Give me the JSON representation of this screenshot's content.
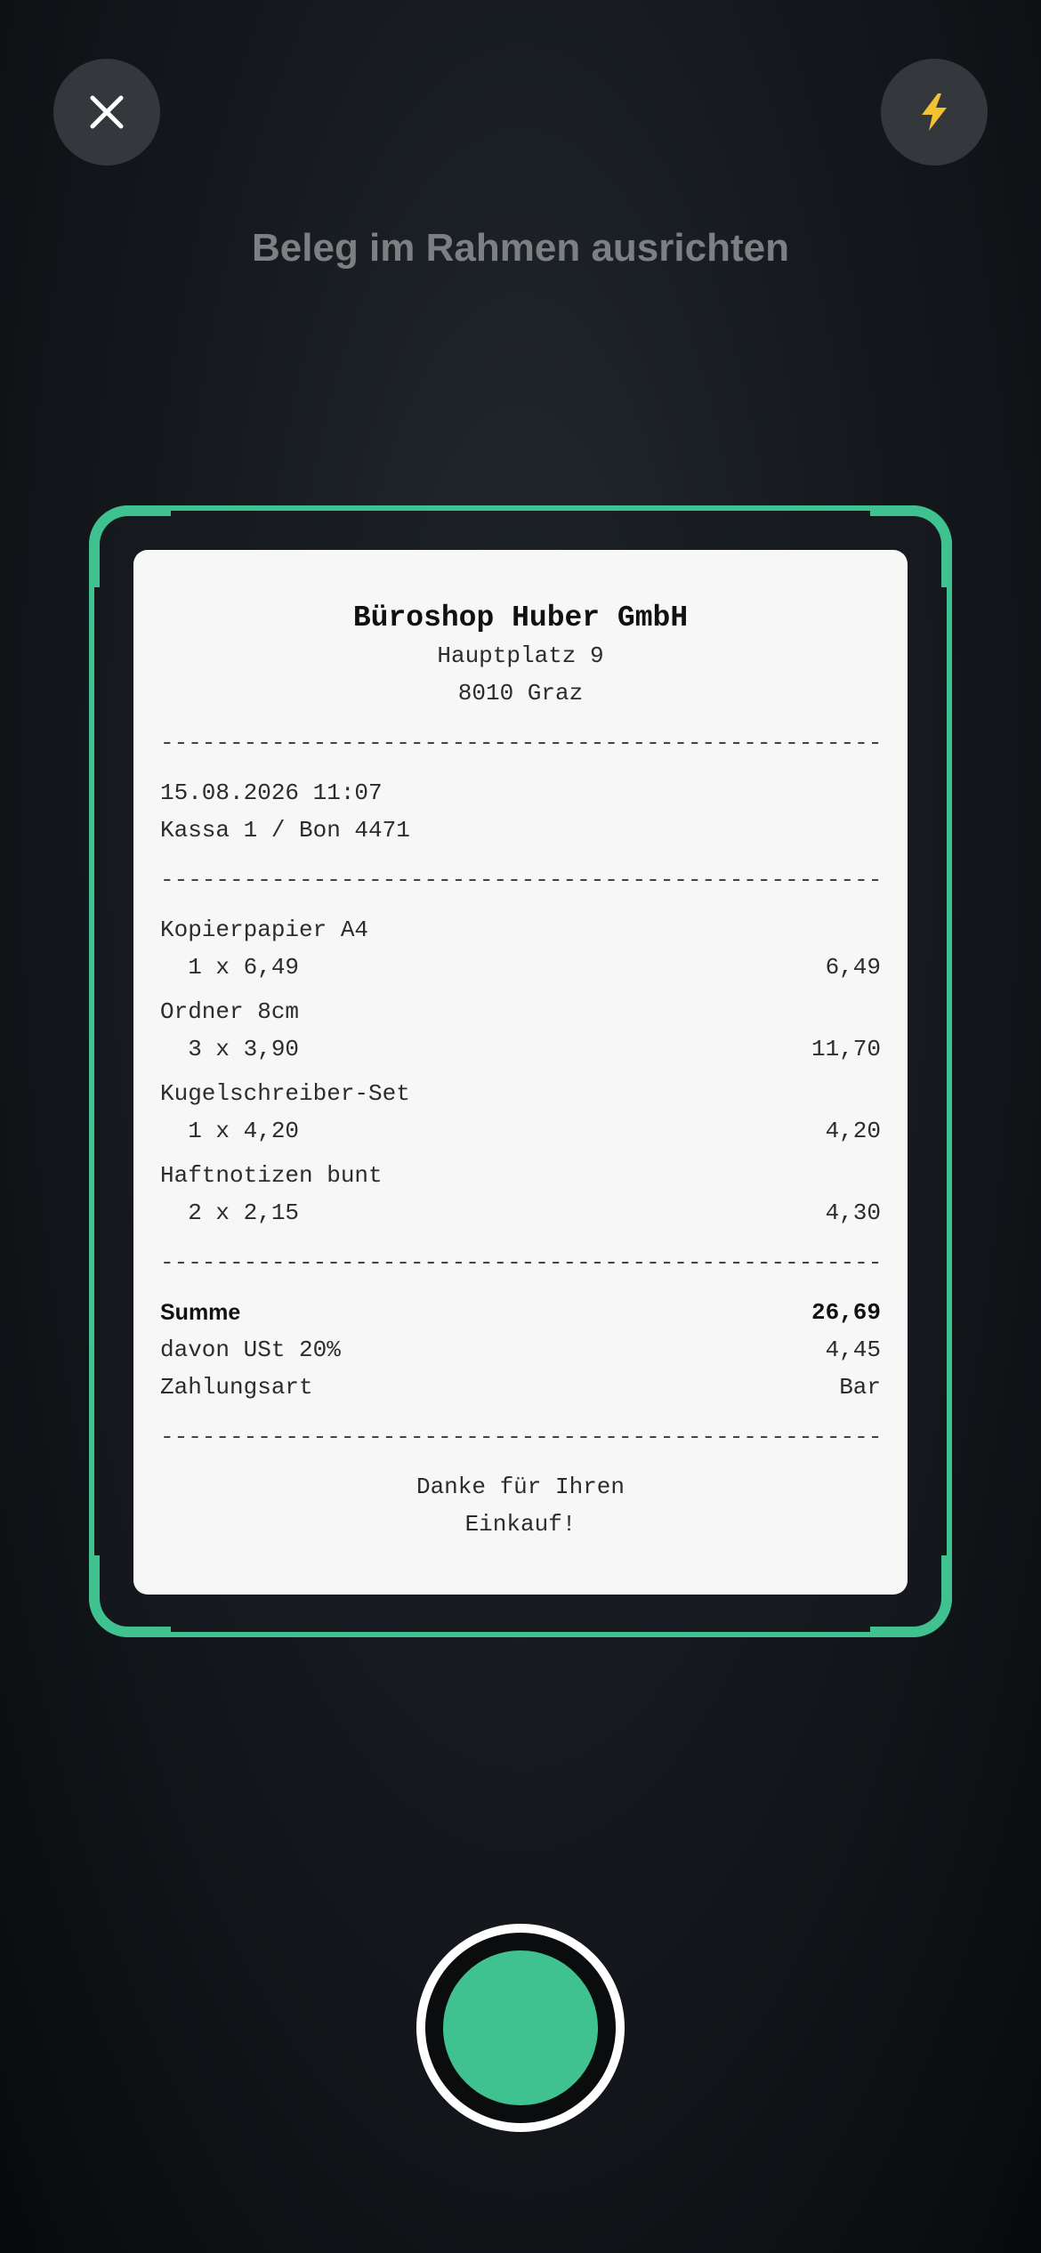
{
  "top_bar": {
    "close_icon": "close-icon",
    "flash_icon": "flash-icon",
    "flash_color": "#f2c230"
  },
  "hint": "Beleg im Rahmen ausrichten",
  "accent_color": "#3fc28f",
  "receipt": {
    "shop_name": "Büroshop Huber GmbH",
    "address_line1": "Hauptplatz 9",
    "address_line2": "8010 Graz",
    "separator": "-------------------------------------------------------",
    "datetime": "15.08.2026 11:07",
    "register": "Kassa 1 / Bon 4471",
    "items": [
      {
        "name": "Kopierpapier A4",
        "qty_price": "  1 x 6,49",
        "total": "6,49"
      },
      {
        "name": "Ordner 8cm",
        "qty_price": "  3 x 3,90",
        "total": "11,70"
      },
      {
        "name": "Kugelschreiber-Set",
        "qty_price": "  1 x 4,20",
        "total": "4,20"
      },
      {
        "name": "Haftnotizen bunt",
        "qty_price": "  2 x 2,15",
        "total": "4,30"
      }
    ],
    "sum_label": "Summe",
    "sum_value": "26,69",
    "vat_label": "davon USt 20%",
    "vat_value": "4,45",
    "payment_label": "Zahlungsart",
    "payment_value": "Bar",
    "thanks_line1": "Danke für Ihren",
    "thanks_line2": "Einkauf!"
  },
  "shutter": {
    "icon": "shutter-button"
  }
}
